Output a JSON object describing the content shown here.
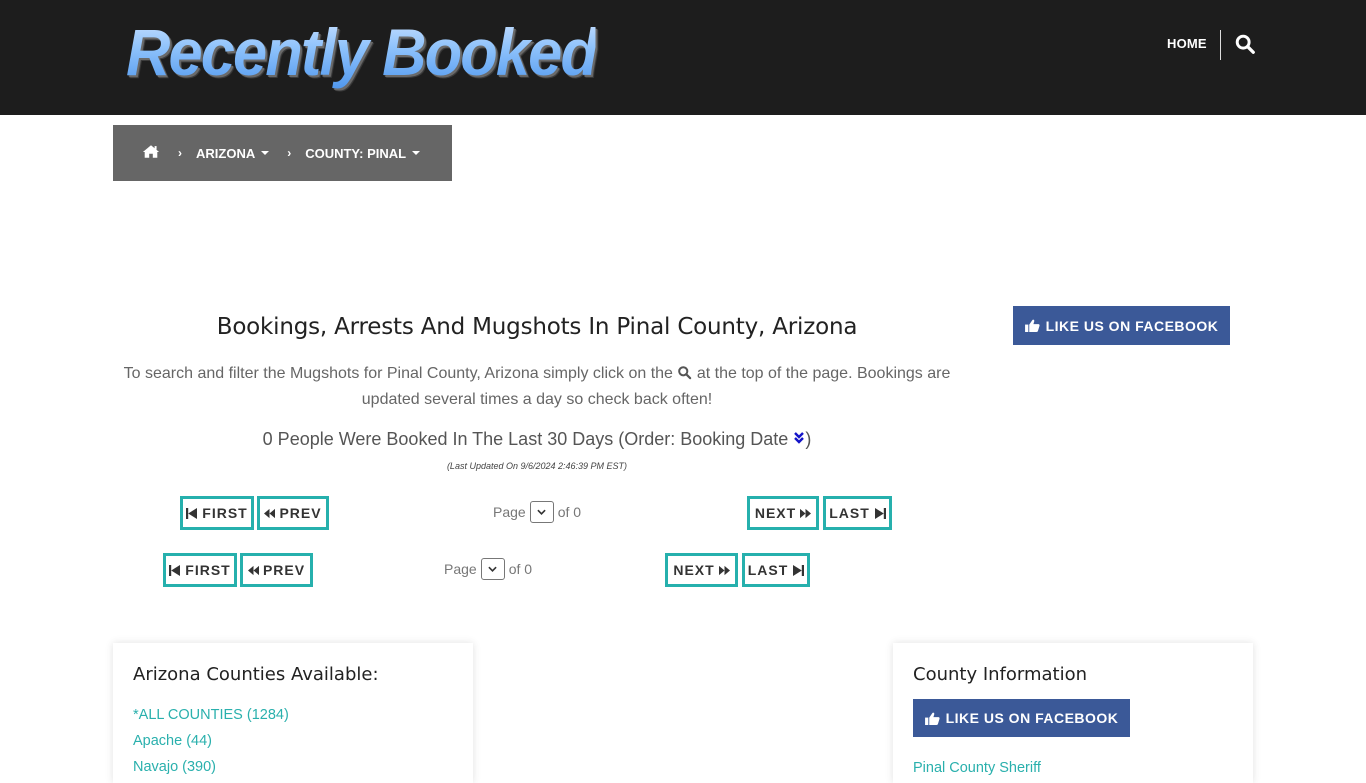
{
  "header": {
    "logo_text": "Recently Booked",
    "nav_home": "HOME",
    "search_icon": "search-icon"
  },
  "breadcrumb": {
    "home_icon": "home-icon",
    "separator": "›",
    "items": [
      {
        "label": "ARIZONA",
        "has_dropdown": true
      },
      {
        "label": "COUNTY: PINAL",
        "has_dropdown": true
      }
    ]
  },
  "main": {
    "title": "Bookings, Arrests And Mugshots In Pinal County, Arizona",
    "intro_before": "To search and filter the Mugshots for Pinal County, Arizona simply click on the",
    "intro_after": "at the top of the page. Bookings are updated several times a day so check back often!",
    "booked_count": "0 People Were Booked In The Last 30 Days (Order: Booking Date",
    "order_icon": "double-chevron-down-icon",
    "booked_close": ")",
    "last_updated": "(Last Updated On 9/6/2024 2:46:39 PM EST)"
  },
  "pagination": {
    "first": "FIRST",
    "prev": "PREV",
    "next": "NEXT",
    "last": "LAST",
    "page_label": "Page",
    "of_label": "of 0",
    "selected_page": ""
  },
  "facebook": {
    "label": "LIKE US ON FACEBOOK",
    "color": "#3b5998"
  },
  "counties_card": {
    "title": "Arizona Counties Available:",
    "items": [
      {
        "label": "*ALL COUNTIES (1284)"
      },
      {
        "label": "Apache (44)"
      },
      {
        "label": "Navajo (390)"
      }
    ]
  },
  "county_info_card": {
    "title": "County Information",
    "link_partial": "Pinal County Sheriff"
  },
  "colors": {
    "accent": "#26b0ad",
    "topbar": "#1d1d1d",
    "breadcrumb_bg": "#666666"
  }
}
